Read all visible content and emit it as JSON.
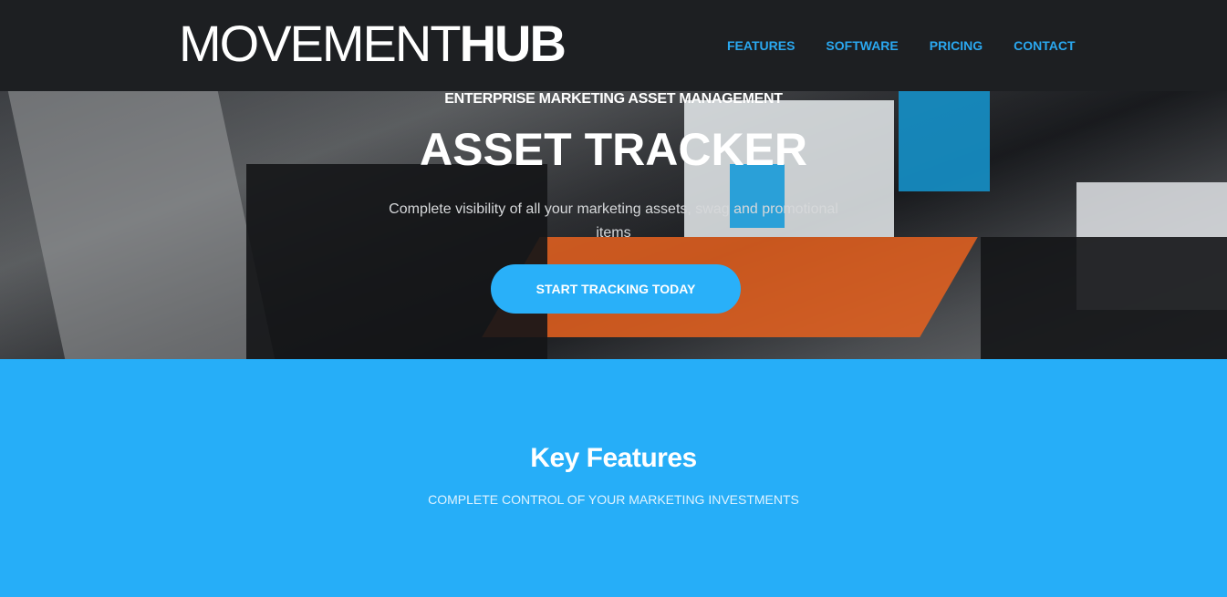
{
  "header": {
    "logo_light": "MOVEMENT",
    "logo_bold": "HUB",
    "nav": [
      {
        "label": "FEATURES"
      },
      {
        "label": "SOFTWARE"
      },
      {
        "label": "PRICING"
      },
      {
        "label": "CONTACT"
      }
    ]
  },
  "hero": {
    "eyebrow": "ENTERPRISE MARKETING ASSET MANAGEMENT",
    "title": "ASSET TRACKER",
    "subtitle": "Complete visibility of all your marketing assets, swag and promotional items",
    "cta_label": "START TRACKING TODAY"
  },
  "features": {
    "title": "Key Features",
    "subtitle": "COMPLETE CONTROL OF YOUR MARKETING INVESTMENTS"
  },
  "colors": {
    "header_bg": "#1d1f22",
    "nav_link": "#2aa8f0",
    "accent": "#29b0f9",
    "features_bg": "#26aef8"
  }
}
